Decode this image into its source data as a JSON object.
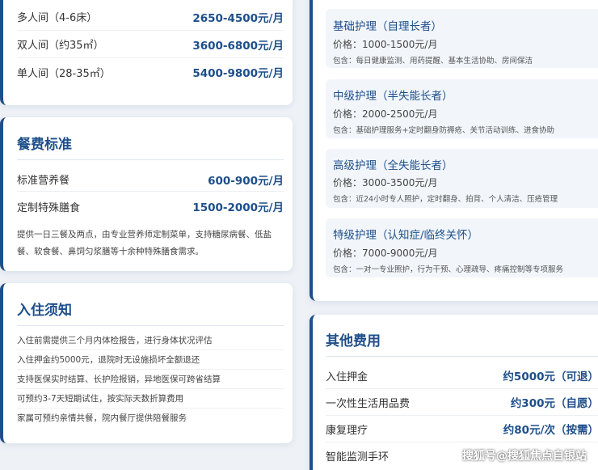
{
  "room_card": {
    "rows": [
      {
        "label": "多人间（4-6床）",
        "value": "2650-4500元/月"
      },
      {
        "label": "双人间（约35㎡）",
        "value": "3600-6800元/月"
      },
      {
        "label": "单人间（28-35㎡）",
        "value": "5400-9800元/月"
      }
    ]
  },
  "meal_card": {
    "title": "餐费标准",
    "rows": [
      {
        "label": "标准营养餐",
        "value": "600-900元/月"
      },
      {
        "label": "定制特殊膳食",
        "value": "1500-2000元/月"
      }
    ],
    "note_line1": "提供一日三餐及两点，由专业营养师定制菜单，支持糖尿病餐、低盐",
    "note_line2": "餐、软食餐、鼻饲匀浆膳等十余种特殊膳食需求。"
  },
  "notice_card": {
    "title": "入住须知",
    "items": [
      "入住前需提供三个月内体检报告，进行身体状况评估",
      "入住押金约5000元，退院时无设施损坏全额退还",
      "支持医保实时结算、长护险报销，异地医保可跨省结算",
      "可预约3-7天短期试住，按实际天数折算费用",
      "家属可预约亲情共餐，院内餐厅提供陪餐服务"
    ]
  },
  "care_card": {
    "levels": [
      {
        "title": "基础护理（自理长者）",
        "price": "价格：1000-1500元/月",
        "includes": "包含：每日健康监测、用药提醒、基本生活协助、房间保洁"
      },
      {
        "title": "中级护理（半失能长者）",
        "price": "价格：2000-2500元/月",
        "includes": "包含：基础护理服务+定时翻身防褥疮、关节活动训练、进食协助"
      },
      {
        "title": "高级护理（全失能长者）",
        "price": "价格：3000-3500元/月",
        "includes": "包含：近24小时专人照护，定时翻身、拍背、个人清洁、压疮管理"
      },
      {
        "title": "特级护理（认知症/临终关怀）",
        "price": "价格：7000-9000元/月",
        "includes": "包含：一对一专业照护，行为干预、心理疏导、疼痛控制等专项服务"
      }
    ]
  },
  "other_card": {
    "title": "其他费用",
    "rows": [
      {
        "label": "入住押金",
        "value": "约5000元（可退）"
      },
      {
        "label": "一次性生活用品费",
        "value": "约300元（自愿）"
      },
      {
        "label": "康复理疗",
        "value": "约80元/次（按需）"
      },
      {
        "label": "智能监测手环",
        "value": ""
      }
    ]
  },
  "watermark": "搜狐号@搜狐焦点自银站"
}
